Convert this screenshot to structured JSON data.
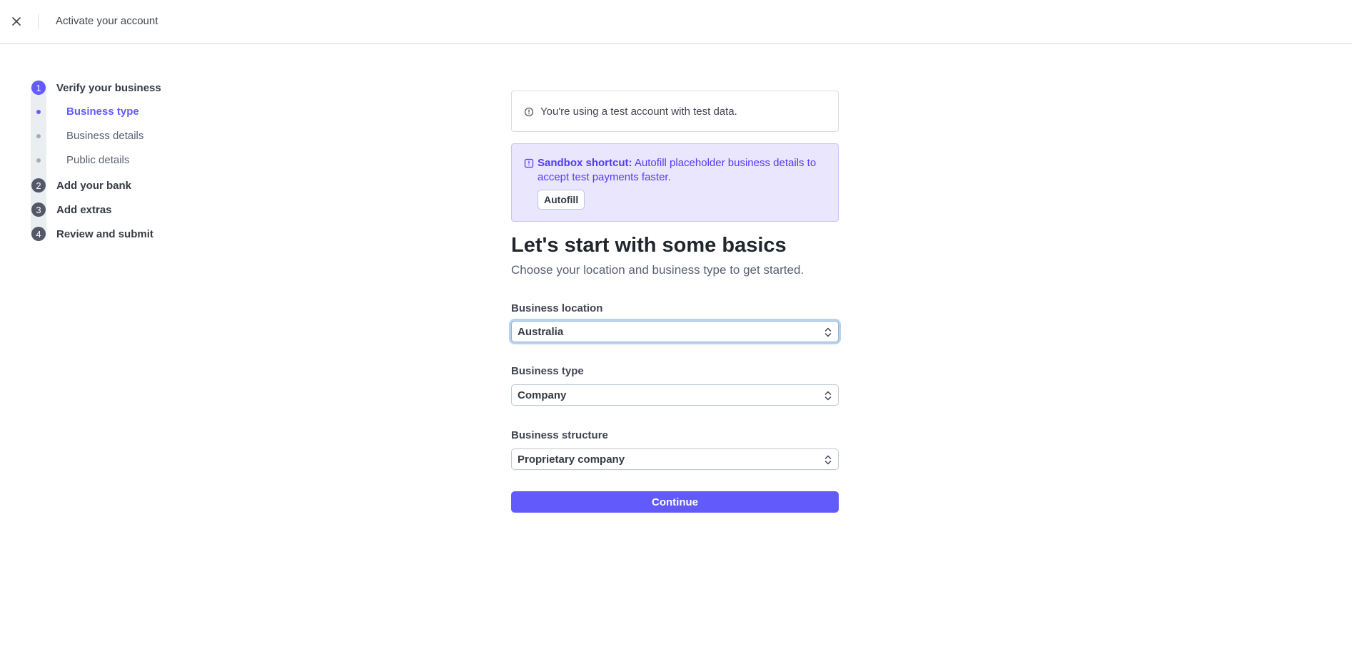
{
  "header": {
    "title": "Activate your account",
    "close_icon": "close-icon"
  },
  "stepper": {
    "steps": [
      {
        "number": "1",
        "label": "Verify your business",
        "active": true
      },
      {
        "number": "2",
        "label": "Add your bank",
        "active": false
      },
      {
        "number": "3",
        "label": "Add extras",
        "active": false
      },
      {
        "number": "4",
        "label": "Review and submit",
        "active": false
      }
    ],
    "substeps": [
      {
        "label": "Business type",
        "active": true
      },
      {
        "label": "Business details",
        "active": false
      },
      {
        "label": "Public details",
        "active": false
      }
    ]
  },
  "notice": {
    "icon": "info-circle-icon",
    "text": "You're using a test account with test data."
  },
  "sandbox": {
    "icon": "info-square-icon",
    "title": "Sandbox shortcut:",
    "text": " Autofill placeholder business details to accept test payments faster.",
    "button_label": "Autofill"
  },
  "main": {
    "heading": "Let's start with some basics",
    "subheading": "Choose your location and business type to get started."
  },
  "form": {
    "location_label": "Business location",
    "location_value": "Australia",
    "type_label": "Business type",
    "type_value": "Company",
    "structure_label": "Business structure",
    "structure_value": "Proprietary company",
    "continue_label": "Continue"
  },
  "colors": {
    "accent": "#635bff",
    "sandbox_bg": "#e9e6fd",
    "text": "#30313d"
  }
}
